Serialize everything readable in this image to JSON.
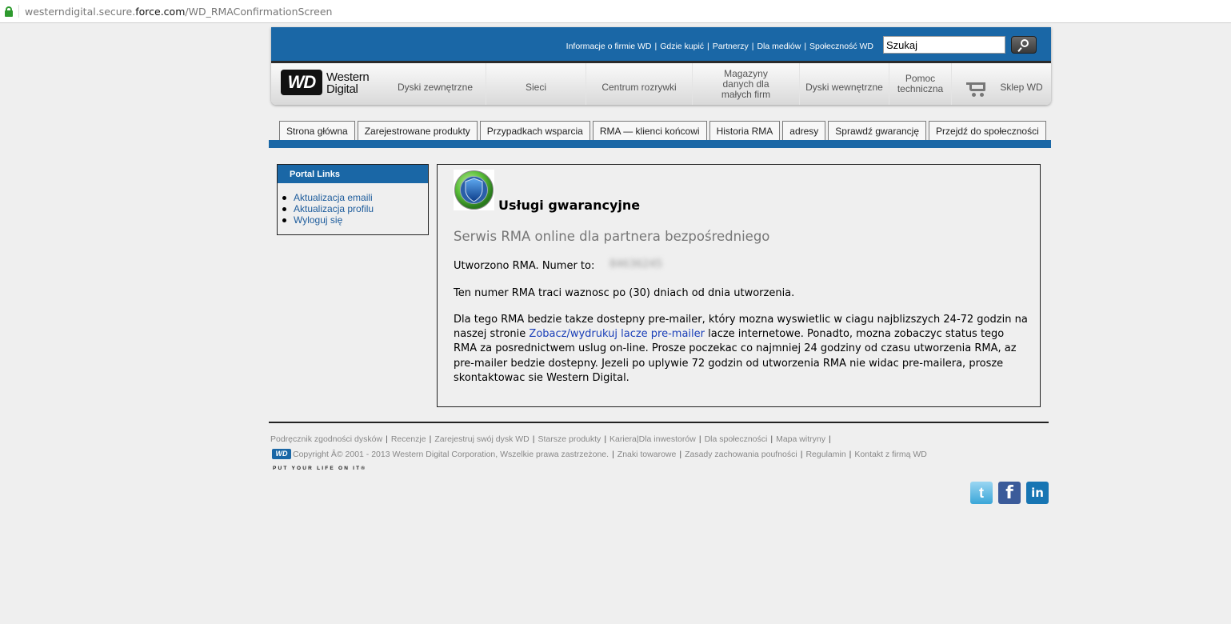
{
  "browser": {
    "url_prefix": "westerndigital.secure.",
    "url_domain": "force.com",
    "url_path": "/WD_RMAConfirmationScreen"
  },
  "header": {
    "top_links": [
      "Informacje o firmie WD",
      "Gdzie kupić",
      "Partnerzy",
      "Dla mediów",
      "Społeczność WD"
    ],
    "search_value": "Szukaj",
    "logo_line1": "Western",
    "logo_line2": "Digital",
    "logo_mark": "WD",
    "nav": [
      "Dyski zewnętrzne",
      "Sieci",
      "Centrum rozrywki",
      "Magazyny danych dla małych firm",
      "Dyski wewnętrzne",
      "Pomoc techniczna",
      "Sklep WD"
    ]
  },
  "tabs": [
    "Strona główna",
    "Zarejestrowane produkty",
    "Przypadkach wsparcia",
    "RMA — klienci końcowi",
    "Historia RMA",
    "adresy",
    "Sprawdź gwarancję",
    "Przejdź do społeczności"
  ],
  "portal": {
    "title": "Portal Links",
    "links": [
      "Aktualizacja emaili",
      "Aktualizacja profilu",
      "Wyloguj się"
    ]
  },
  "content": {
    "title": "Usługi gwarancyjne",
    "subtitle": "Serwis RMA online dla partnera bezpośredniego",
    "rma_label": "Utworzono RMA. Numer to:",
    "rma_number": "84636245",
    "expiry": "Ten numer RMA traci waznosc po (30) dniach od dnia utworzenia.",
    "para_before": "Dla tego RMA bedzie takze dostepny pre-mailer, który mozna wyswietlic w ciagu najblizszych 24-72 godzin na naszej stronie ",
    "para_link": "Zobacz/wydrukuj lacze pre-mailer",
    "para_after": " lacze internetowe. Ponadto, mozna zobaczyc status tego RMA za posrednictwem uslug on-line. Prosze poczekac co najmniej 24 godziny od czasu utworzenia RMA, az pre-mailer bedzie dostepny. Jezeli po uplywie 72 godzin od utworzenia RMA nie widac pre-mailera, prosze skontaktowac sie Western Digital."
  },
  "footer": {
    "row1": [
      "Podręcznik zgodności dysków",
      "Recenzje",
      "Zarejestruj swój dysk WD",
      "Starsze produkty",
      "Kariera|Dla inwestorów",
      "Dla społeczności",
      "Mapa witryny"
    ],
    "copyright": "Copyright Â© 2001 - 2013 Western Digital Corporation, Wszelkie prawa zastrzeżone.",
    "row2": [
      "Znaki towarowe",
      "Zasady zachowania poufności",
      "Regulamin",
      "Kontakt z firmą WD"
    ],
    "tagline": "PUT YOUR LIFE ON IT®",
    "social": {
      "twitter": "t",
      "facebook": "f",
      "linkedin": "in"
    }
  }
}
